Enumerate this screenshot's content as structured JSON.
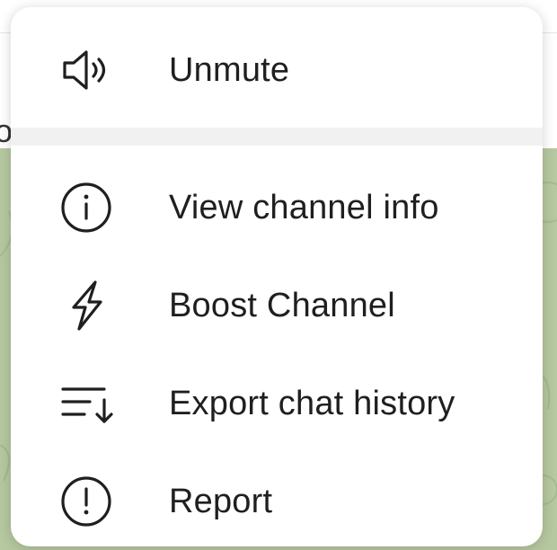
{
  "background": {
    "header_glyph": "o",
    "chat_bg_color": "#b6c8a0"
  },
  "menu": {
    "items": [
      {
        "label": "Unmute",
        "icon": "speaker-icon"
      },
      {
        "label": "View channel info",
        "icon": "info-icon"
      },
      {
        "label": "Boost Channel",
        "icon": "lightning-icon"
      },
      {
        "label": "Export chat history",
        "icon": "sort-down-icon"
      },
      {
        "label": "Report",
        "icon": "exclamation-circle-icon"
      }
    ]
  },
  "colors": {
    "text": "#1f1f1f",
    "icon": "#1f1f1f",
    "separator": "#f1f1f1"
  }
}
